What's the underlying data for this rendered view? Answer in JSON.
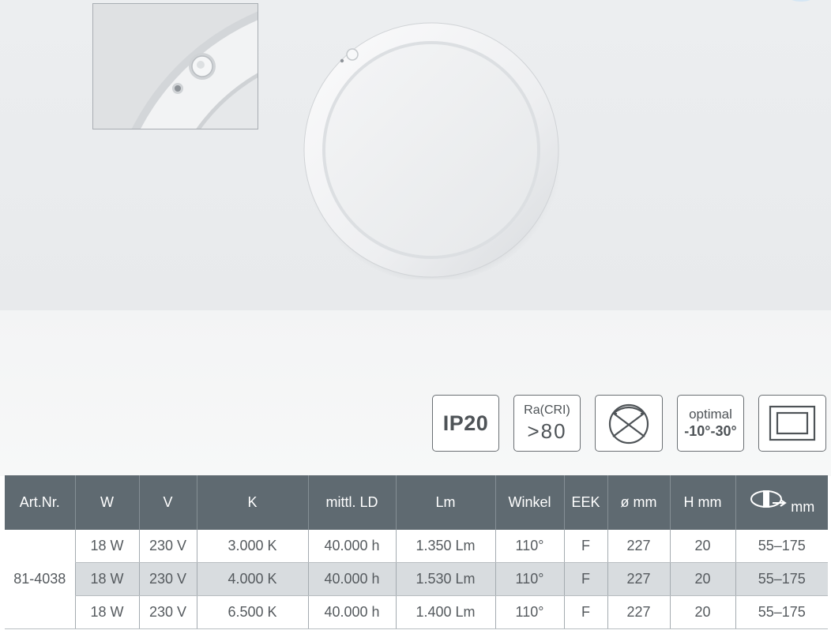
{
  "badges": {
    "ip": "IP20",
    "cri_label": "Ra(CRI)",
    "cri_value": ">80",
    "optimal_label": "optimal",
    "optimal_value": "-10°-30°"
  },
  "icons": [
    "beam-angle-icon",
    "installation-frame-icon",
    "cutout-diameter-icon"
  ],
  "colors": {
    "header_bg": "#5f6a71",
    "alt_row": "#d8dcdf",
    "text": "#555a5e"
  },
  "table": {
    "headers": [
      "Art.Nr.",
      "W",
      "V",
      "K",
      "mittl. LD",
      "Lm",
      "Winkel",
      "EEK",
      "ø mm",
      "H mm",
      "mm"
    ],
    "art_nr": "81-4038",
    "rows": [
      [
        "18 W",
        "230 V",
        "3.000 K",
        "40.000 h",
        "1.350 Lm",
        "110°",
        "F",
        "227",
        "20",
        "55–175"
      ],
      [
        "18 W",
        "230 V",
        "4.000 K",
        "40.000 h",
        "1.530 Lm",
        "110°",
        "F",
        "227",
        "20",
        "55–175"
      ],
      [
        "18 W",
        "230 V",
        "6.500 K",
        "40.000 h",
        "1.400 Lm",
        "110°",
        "F",
        "227",
        "20",
        "55–175"
      ]
    ]
  }
}
